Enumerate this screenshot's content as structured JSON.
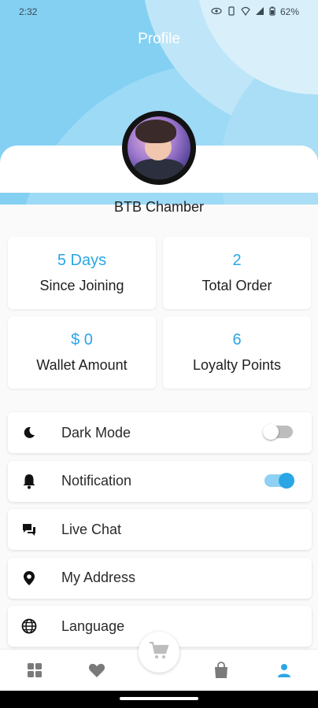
{
  "status_bar": {
    "time": "2:32",
    "battery": "62%"
  },
  "header": {
    "title": "Profile"
  },
  "profile": {
    "name": "BTB Chamber"
  },
  "stats": [
    {
      "value": "5 Days",
      "label": "Since Joining"
    },
    {
      "value": "2",
      "label": "Total Order"
    },
    {
      "value": "$ 0",
      "label": "Wallet Amount"
    },
    {
      "value": "6",
      "label": "Loyalty Points"
    }
  ],
  "settings": [
    {
      "label": "Dark Mode",
      "icon": "moon-icon",
      "toggle": false
    },
    {
      "label": "Notification",
      "icon": "bell-icon",
      "toggle": true
    },
    {
      "label": "Live Chat",
      "icon": "chat-icon"
    },
    {
      "label": "My Address",
      "icon": "location-pin-icon"
    },
    {
      "label": "Language",
      "icon": "globe-icon"
    }
  ],
  "bottom_nav": [
    {
      "icon": "grid-icon"
    },
    {
      "icon": "heart-icon"
    },
    {
      "icon": "cart-icon"
    },
    {
      "icon": "shopping-bag-icon"
    },
    {
      "icon": "person-icon",
      "active": true
    }
  ],
  "colors": {
    "accent": "#2aa6e5",
    "header_bg": "#84d0f3",
    "nav_inactive": "#7a7a7a"
  }
}
